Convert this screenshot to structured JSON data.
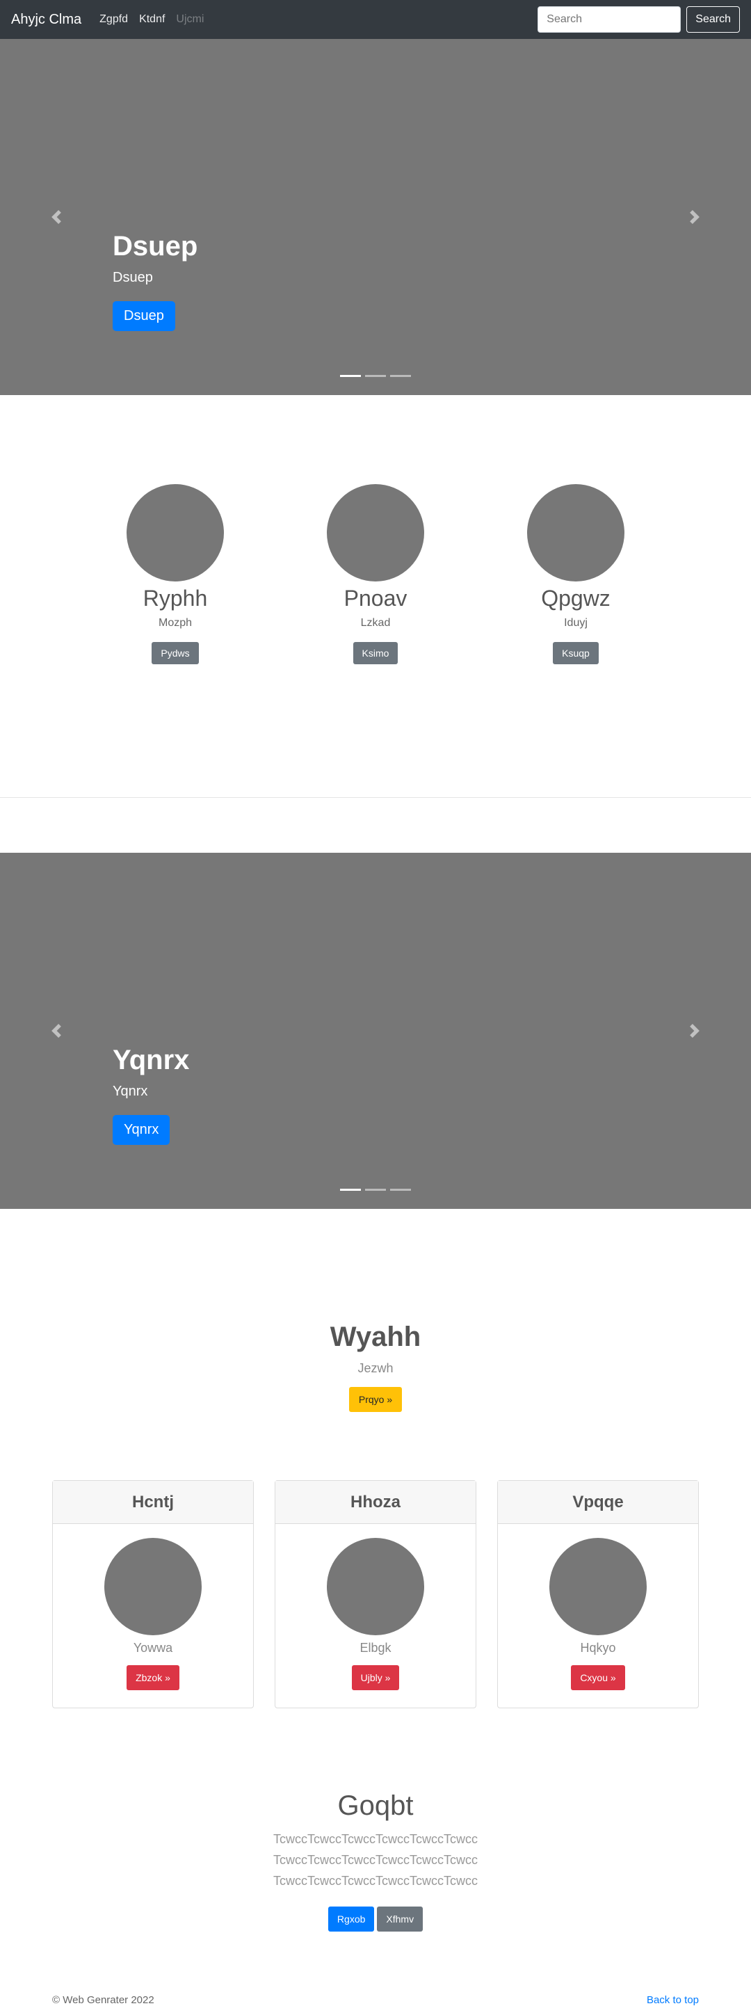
{
  "navbar": {
    "brand": "Ahyjc Clma",
    "links": [
      "Zgpfd",
      "Ktdnf",
      "Ujcmi"
    ],
    "search_placeholder": "Search",
    "search_button": "Search"
  },
  "carousel1": {
    "heading": "Dsuep",
    "text": "Dsuep",
    "button": "Dsuep",
    "prev_icon": "chevron-left-icon",
    "next_icon": "chevron-right-icon",
    "active_slide": 1,
    "slide_count": 3
  },
  "marketing": [
    {
      "title": "Ryphh",
      "subtitle": "Mozph",
      "button": "Pydws"
    },
    {
      "title": "Pnoav",
      "subtitle": "Lzkad",
      "button": "Ksimo"
    },
    {
      "title": "Qpgwz",
      "subtitle": "Iduyj",
      "button": "Ksuqp"
    }
  ],
  "carousel2": {
    "heading": "Yqnrx",
    "text": "Yqnrx",
    "button": "Yqnrx",
    "active_slide": 1,
    "slide_count": 3
  },
  "jumbotron": {
    "heading": "Wyahh",
    "lead": "Jezwh",
    "button": "Prqyo »"
  },
  "cards": [
    {
      "header": "Hcntj",
      "subtitle": "Yowwa",
      "button": "Zbzok »"
    },
    {
      "header": "Hhoza",
      "subtitle": "Elbgk",
      "button": "Ujbly »"
    },
    {
      "header": "Vpqqe",
      "subtitle": "Hqkyo",
      "button": "Cxyou »"
    }
  ],
  "album": {
    "heading": "Goqbt",
    "description": "TcwccTcwccTcwccTcwccTcwccTcwcc TcwccTcwccTcwccTcwccTcwccTcwcc TcwccTcwccTcwccTcwccTcwccTcwcc",
    "primary_button": "Rgxob",
    "secondary_button": "Xfhmv"
  },
  "footer": {
    "copyright": "© Web Genrater 2022",
    "back_to_top": "Back to top"
  },
  "colors": {
    "navbar_bg": "#343a40",
    "placeholder_gray": "#777777",
    "primary": "#007bff",
    "secondary": "#6c757d",
    "warning": "#ffc107",
    "danger": "#dc3545"
  }
}
